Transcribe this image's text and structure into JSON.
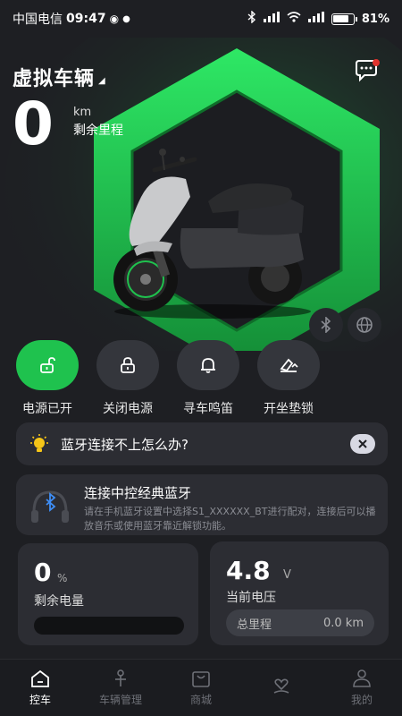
{
  "status_bar": {
    "carrier": "中国电信",
    "time": "09:47",
    "battery_text": "81%",
    "battery_level": 0.81
  },
  "vehicle": {
    "name": "虚拟车辆"
  },
  "range": {
    "value": "0",
    "unit": "km",
    "label": "剩余里程"
  },
  "controls": [
    {
      "label": "电源已开",
      "icon": "unlock-icon",
      "active": true
    },
    {
      "label": "关闭电源",
      "icon": "lock-icon",
      "active": false
    },
    {
      "label": "寻车鸣笛",
      "icon": "bell-icon",
      "active": false
    },
    {
      "label": "开坐垫锁",
      "icon": "seat-unlock-icon",
      "active": false
    }
  ],
  "faq": {
    "text": "蓝牙连接不上怎么办?"
  },
  "bluetooth_card": {
    "title": "连接中控经典蓝牙",
    "description": "请在手机蓝牙设置中选择S1_XXXXXX_BT进行配对，连接后可以播放音乐或使用蓝牙靠近解锁功能。"
  },
  "battery_card": {
    "value": "0",
    "unit": "%",
    "label": "剩余电量",
    "level": 0
  },
  "voltage_card": {
    "value": "4.8",
    "unit": "V",
    "label": "当前电压",
    "odometer_label": "总里程",
    "odometer_value": "0.0 km"
  },
  "tabs": [
    {
      "label": "控车",
      "icon": "home-icon",
      "active": true
    },
    {
      "label": "车辆管理",
      "icon": "scooter-icon",
      "active": false
    },
    {
      "label": "商城",
      "icon": "shop-bag-icon",
      "active": false
    },
    {
      "label": "",
      "icon": "heart-hand-icon",
      "active": false
    },
    {
      "label": "我的",
      "icon": "person-icon",
      "active": false
    }
  ],
  "colors": {
    "accent": "#1fc24e",
    "background": "#1e1f23",
    "card": "#2c2d33"
  }
}
